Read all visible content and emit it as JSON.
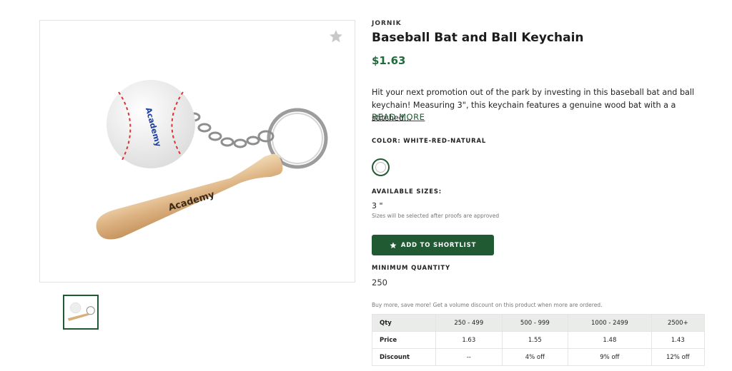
{
  "product": {
    "brand": "JORNIK",
    "title": "Baseball Bat and Ball Keychain",
    "price": "$1.63",
    "description": "Hit your next promotion out of the park by investing in this baseball bat and ball keychain! Measuring 3\", this keychain features a genuine wood bat with a a stitched...",
    "read_more": "READ MORE",
    "color_label": "COLOR: WHITE-RED-NATURAL",
    "sizes_label": "AVAILABLE SIZES:",
    "size_value": "3 \"",
    "size_note": "Sizes will be selected after proofs are approved",
    "shortlist_label": "ADD TO SHORTLIST",
    "min_qty_label": "MINIMUM QUANTITY",
    "min_qty_value": "250",
    "volume_note": "Buy more, save more! Get a volume discount on this product when more are ordered.",
    "art_logo_text": "Academy",
    "art_ball_text": "Academy"
  },
  "pricing_table": {
    "header": [
      "Qty",
      "250 - 499",
      "500 - 999",
      "1000 - 2499",
      "2500+"
    ],
    "rows": [
      [
        "Price",
        "1.63",
        "1.55",
        "1.48",
        "1.43"
      ],
      [
        "Discount",
        "--",
        "4% off",
        "9% off",
        "12% off"
      ]
    ]
  },
  "icons": {
    "favorite": "star-icon",
    "shortlist": "star-icon"
  },
  "colors": {
    "accent": "#1f5a33",
    "price": "#1f6b3a",
    "table_header": "#e9ece9"
  }
}
